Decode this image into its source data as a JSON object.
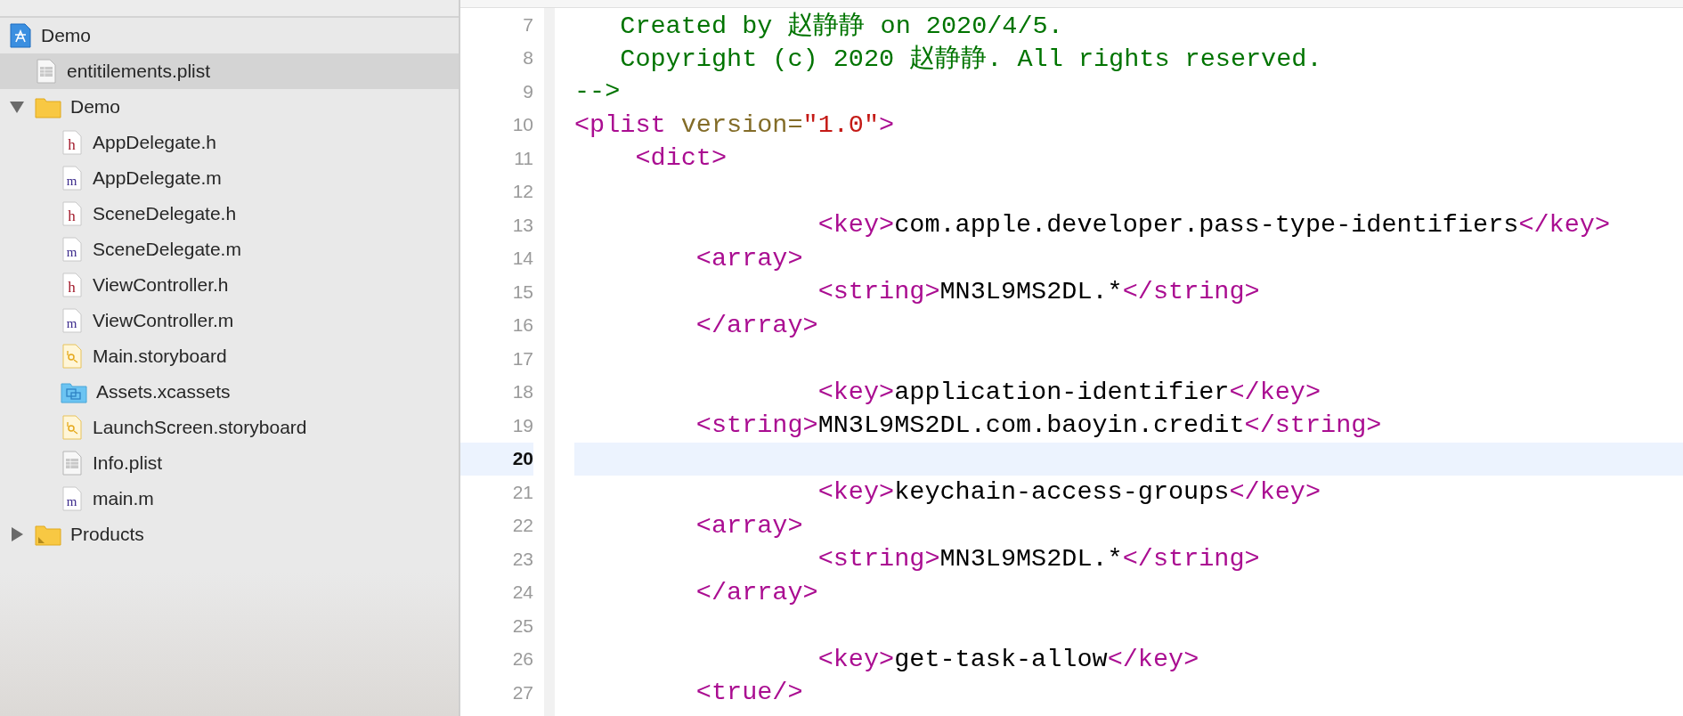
{
  "navigator": {
    "items": [
      {
        "name": "Demo",
        "kind": "project",
        "selected": false,
        "children": [
          {
            "name": "entitilements.plist",
            "kind": "plist",
            "selected": true
          },
          {
            "name": "Demo",
            "kind": "folder",
            "selected": false,
            "expanded": true,
            "children": [
              {
                "name": "AppDelegate.h",
                "kind": "h",
                "selected": false
              },
              {
                "name": "AppDelegate.m",
                "kind": "m",
                "selected": false
              },
              {
                "name": "SceneDelegate.h",
                "kind": "h",
                "selected": false
              },
              {
                "name": "SceneDelegate.m",
                "kind": "m",
                "selected": false
              },
              {
                "name": "ViewController.h",
                "kind": "h",
                "selected": false
              },
              {
                "name": "ViewController.m",
                "kind": "m",
                "selected": false
              },
              {
                "name": "Main.storyboard",
                "kind": "storyboard",
                "selected": false
              },
              {
                "name": "Assets.xcassets",
                "kind": "xcassets",
                "selected": false
              },
              {
                "name": "LaunchScreen.storyboard",
                "kind": "storyboard",
                "selected": false
              },
              {
                "name": "Info.plist",
                "kind": "plist",
                "selected": false
              },
              {
                "name": "main.m",
                "kind": "m",
                "selected": false
              }
            ]
          },
          {
            "name": "Products",
            "kind": "products",
            "selected": false,
            "expanded": false
          }
        ]
      }
    ]
  },
  "editor": {
    "lines": [
      {
        "number": "7",
        "current": false,
        "tokens": [
          {
            "kind": "comment",
            "text": "   Created by 赵静静 on 2020/4/5."
          }
        ]
      },
      {
        "number": "8",
        "current": false,
        "tokens": [
          {
            "kind": "comment",
            "text": "   Copyright (c) 2020 赵静静. All rights reserved."
          }
        ]
      },
      {
        "number": "9",
        "current": false,
        "tokens": [
          {
            "kind": "comment",
            "text": "-->"
          }
        ]
      },
      {
        "number": "10",
        "current": false,
        "tokens": [
          {
            "kind": "tag",
            "text": "<plist"
          },
          {
            "kind": "attr",
            "text": " version="
          },
          {
            "kind": "value",
            "text": "\"1.0\""
          },
          {
            "kind": "tag",
            "text": ">"
          }
        ]
      },
      {
        "number": "11",
        "current": false,
        "tokens": [
          {
            "kind": "tag",
            "text": "    <dict>"
          }
        ]
      },
      {
        "number": "12",
        "current": false
      },
      {
        "number": "13",
        "current": false,
        "tokens": [
          {
            "kind": "tag",
            "text": "                <key>"
          },
          {
            "kind": "text",
            "text": "com.apple.developer.pass-type-identifiers"
          },
          {
            "kind": "tag",
            "text": "</key>"
          }
        ]
      },
      {
        "number": "14",
        "current": false,
        "tokens": [
          {
            "kind": "tag",
            "text": "        <array>"
          }
        ]
      },
      {
        "number": "15",
        "current": false,
        "tokens": [
          {
            "kind": "tag",
            "text": "                <string>"
          },
          {
            "kind": "text",
            "text": "MN3L9MS2DL.*"
          },
          {
            "kind": "tag",
            "text": "</string>"
          }
        ]
      },
      {
        "number": "16",
        "current": false,
        "tokens": [
          {
            "kind": "tag",
            "text": "        </array>"
          }
        ]
      },
      {
        "number": "17",
        "current": false
      },
      {
        "number": "18",
        "current": false,
        "tokens": [
          {
            "kind": "tag",
            "text": "                <key>"
          },
          {
            "kind": "text",
            "text": "application-identifier"
          },
          {
            "kind": "tag",
            "text": "</key>"
          }
        ]
      },
      {
        "number": "19",
        "current": false,
        "tokens": [
          {
            "kind": "tag",
            "text": "        <string>"
          },
          {
            "kind": "text",
            "text": "MN3L9MS2DL.com.baoyin.credit"
          },
          {
            "kind": "tag",
            "text": "</string>"
          }
        ]
      },
      {
        "number": "20",
        "current": true
      },
      {
        "number": "21",
        "current": false,
        "tokens": [
          {
            "kind": "tag",
            "text": "                <key>"
          },
          {
            "kind": "text",
            "text": "keychain-access-groups"
          },
          {
            "kind": "tag",
            "text": "</key>"
          }
        ]
      },
      {
        "number": "22",
        "current": false,
        "tokens": [
          {
            "kind": "tag",
            "text": "        <array>"
          }
        ]
      },
      {
        "number": "23",
        "current": false,
        "tokens": [
          {
            "kind": "tag",
            "text": "                <string>"
          },
          {
            "kind": "text",
            "text": "MN3L9MS2DL.*"
          },
          {
            "kind": "tag",
            "text": "</string>"
          }
        ]
      },
      {
        "number": "24",
        "current": false,
        "tokens": [
          {
            "kind": "tag",
            "text": "        </array>"
          }
        ]
      },
      {
        "number": "25",
        "current": false
      },
      {
        "number": "26",
        "current": false,
        "tokens": [
          {
            "kind": "tag",
            "text": "                <key>"
          },
          {
            "kind": "text",
            "text": "get-task-allow"
          },
          {
            "kind": "tag",
            "text": "</key>"
          }
        ]
      },
      {
        "number": "27",
        "current": false,
        "tokens": [
          {
            "kind": "tag",
            "text": "        <true/>"
          }
        ]
      }
    ]
  }
}
